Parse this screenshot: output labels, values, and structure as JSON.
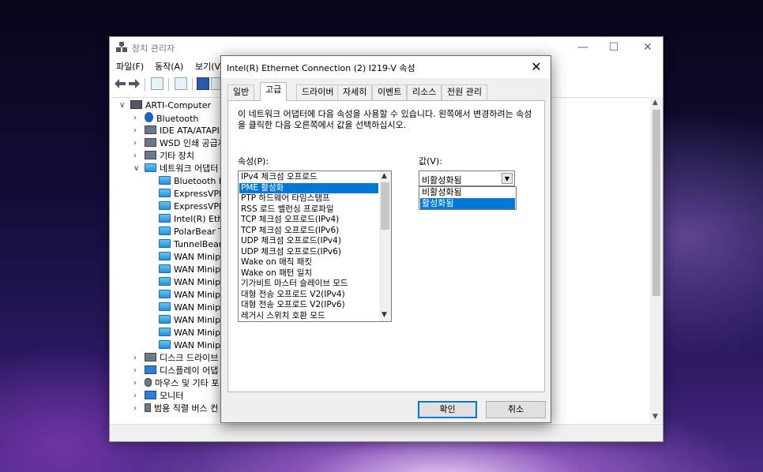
{
  "device_manager": {
    "title": "장치 관리자",
    "caption": {
      "minimize": "—",
      "maximize": "☐",
      "close": "✕"
    },
    "menu": [
      "파일(F)",
      "동작(A)",
      "보기(V"
    ],
    "tree": {
      "root": "ARTI-Computer",
      "items": [
        {
          "label": "Bluetooth",
          "icon": "bluetooth-icon"
        },
        {
          "label": "IDE ATA/ATAPI 컨",
          "icon": "ide-controller-icon"
        },
        {
          "label": "WSD 인쇄 공급자",
          "icon": "printer-icon"
        },
        {
          "label": "기타 장치",
          "icon": "other-device-icon"
        },
        {
          "label": "네트워크 어댑터",
          "icon": "network-adapter-icon"
        }
      ],
      "adapters": [
        "Bluetooth De",
        "ExpressVPN T",
        "ExpressVPN T",
        "Intel(R) Ether",
        "PolarBear Tun",
        "TunnelBear A",
        "WAN Minipo",
        "WAN Minipo",
        "WAN Minipo",
        "WAN Minipo",
        "WAN Minipo",
        "WAN Minipo",
        "WAN Minipo",
        "WAN Minipo"
      ],
      "more": [
        {
          "label": "디스크 드라이브",
          "icon": "disk-drive-icon"
        },
        {
          "label": "디스플레이 어댑",
          "icon": "display-adapter-icon"
        },
        {
          "label": "마우스 및 기타 포",
          "icon": "mouse-icon"
        },
        {
          "label": "모니터",
          "icon": "monitor-icon"
        },
        {
          "label": "범용 직렬 버스 컨",
          "icon": "usb-icon"
        }
      ]
    }
  },
  "dialog": {
    "title": "Intel(R) Ethernet Connection (2) I219-V 속성",
    "close": "✕",
    "tabs": [
      "일반",
      "고급",
      "드라이버",
      "자세히",
      "이벤트",
      "리소스",
      "전원 관리"
    ],
    "active_tab": "고급",
    "description": "이 네트워크 어댑터에 다음 속성을 사용할 수 있습니다. 왼쪽에서 변경하려는 속성을 클릭한 다음 오른쪽에서 값을 선택하십시오.",
    "property_label": "속성(P):",
    "value_label": "값(V):",
    "properties": [
      "IPv4 체크섬 오프로드",
      "PME 활성화",
      "PTP 하드웨어 타임스탬프",
      "RSS 로드 밸런싱 프로파일",
      "TCP 체크섬 오프로드(IPv4)",
      "TCP 체크섬 오프로드(IPv6)",
      "UDP 체크섬 오프로드(IPv4)",
      "UDP 체크섬 오프로드(IPv6)",
      "Wake on 매직 패킷",
      "Wake on 패턴 일치",
      "기가비트 마스터 슬레이브 모드",
      "대형 전송 오프로드 V2(IPv4)",
      "대형 전송 오프로드 V2(IPv6)",
      "레거시 스위치 호환 모드"
    ],
    "selected_property": "PME 활성화",
    "value_selected": "비활성화됨",
    "value_options": [
      "비활성화됨",
      "활성화됨"
    ],
    "highlighted_option": "활성화됨",
    "ok_label": "확인",
    "cancel_label": "취소"
  }
}
